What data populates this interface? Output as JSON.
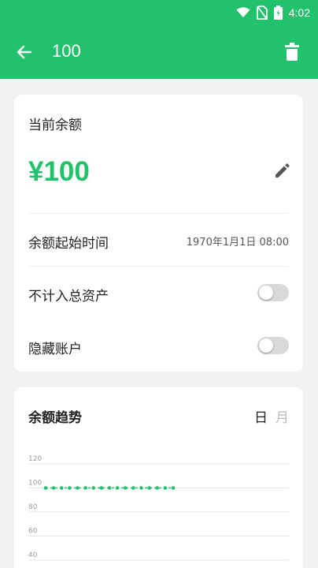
{
  "status_bar": {
    "time": "4:02",
    "icons": [
      "wifi-icon",
      "no-sim-icon",
      "battery-icon"
    ]
  },
  "app_bar": {
    "title": "100",
    "back_icon": "arrow-left-icon",
    "delete_icon": "trash-icon"
  },
  "balance_card": {
    "title": "当前余额",
    "amount": "¥100",
    "edit_icon": "pencil-icon",
    "start_time_label": "余额起始时间",
    "start_time_value": "1970年1月1日 08:00",
    "exclude_total_label": "不计入总资产",
    "exclude_total_on": false,
    "hide_account_label": "隐藏账户",
    "hide_account_on": false
  },
  "trend_card": {
    "title": "余额趋势",
    "tab_day": "日",
    "tab_month": "月",
    "selected_tab": "日"
  },
  "colors": {
    "primary": "#21c26b",
    "toggle_off": "#d9d9d9",
    "tab_inactive": "#bbbbbb"
  },
  "chart_data": {
    "type": "line",
    "y_ticks": [
      "120",
      "100",
      "80",
      "60",
      "40"
    ],
    "ylim": [
      40,
      120
    ],
    "series": [
      {
        "values": [
          100,
          100,
          100,
          100,
          100,
          100,
          100,
          100,
          100,
          100,
          100,
          100,
          100,
          100,
          100,
          100,
          100
        ]
      }
    ],
    "grid": true
  }
}
